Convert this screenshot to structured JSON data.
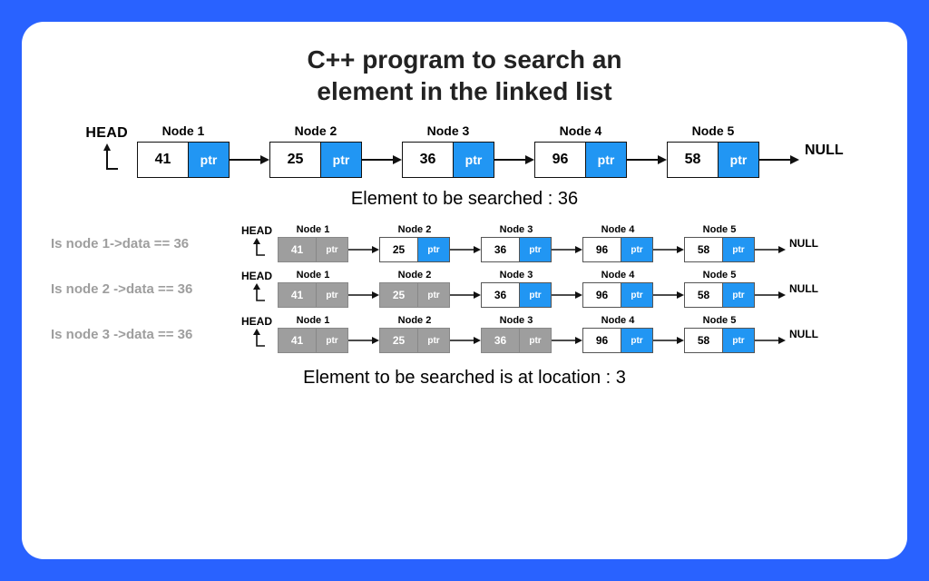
{
  "title_line1": "C++ program to search an",
  "title_line2": "element in the linked list",
  "head_label": "HEAD",
  "null_label": "NULL",
  "ptr_label": "ptr",
  "search_target_text": "Element to be searched : 36",
  "result_text": "Element to be searched is at location : 3",
  "nodes": {
    "n1": {
      "label": "Node 1",
      "value": "41"
    },
    "n2": {
      "label": "Node 2",
      "value": "25"
    },
    "n3": {
      "label": "Node 3",
      "value": "36"
    },
    "n4": {
      "label": "Node 4",
      "value": "96"
    },
    "n5": {
      "label": "Node 5",
      "value": "58"
    }
  },
  "steps": {
    "s1": {
      "question": "Is node 1->data == 36"
    },
    "s2": {
      "question": "Is node 2 ->data == 36"
    },
    "s3": {
      "question": "Is node 3 ->data == 36"
    }
  },
  "chart_data": {
    "type": "table",
    "title": "Linked list search for value 36",
    "nodes": [
      {
        "index": 1,
        "data": 41
      },
      {
        "index": 2,
        "data": 25
      },
      {
        "index": 3,
        "data": 36
      },
      {
        "index": 4,
        "data": 96
      },
      {
        "index": 5,
        "data": 58
      }
    ],
    "search_value": 36,
    "steps": [
      {
        "step": 1,
        "compare_node_index": 1,
        "visited_up_to": 1,
        "match": false
      },
      {
        "step": 2,
        "compare_node_index": 2,
        "visited_up_to": 2,
        "match": false
      },
      {
        "step": 3,
        "compare_node_index": 3,
        "visited_up_to": 3,
        "match": true
      }
    ],
    "found_at_index": 3
  }
}
